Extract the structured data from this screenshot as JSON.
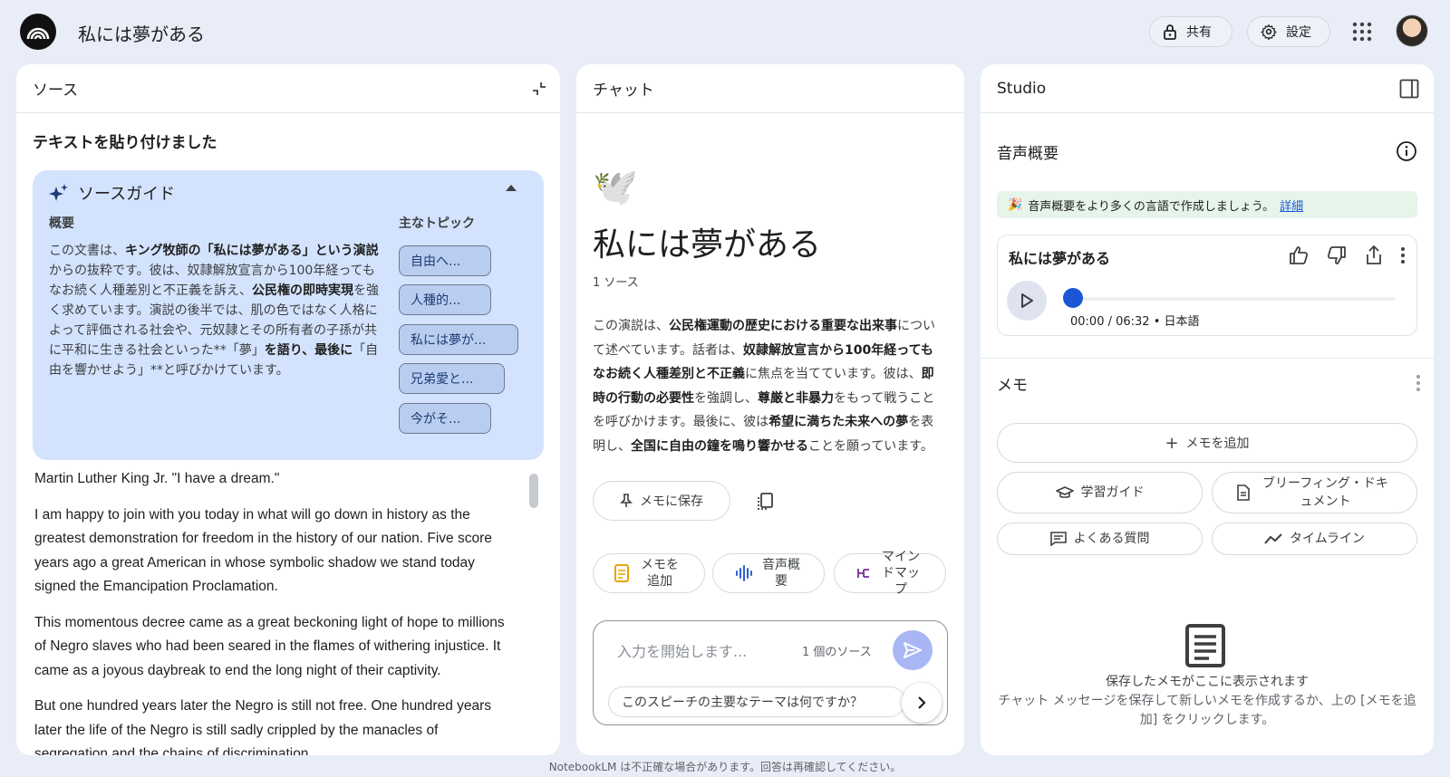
{
  "app": {
    "title": "私には夢がある",
    "share_label": "共有",
    "settings_label": "設定"
  },
  "source_panel": {
    "header": "ソース",
    "subheading": "テキストを貼り付けました",
    "guide": {
      "title": "ソースガイド",
      "summary_label": "概要",
      "topics_label": "主なトピック",
      "summary_parts": [
        "この文書は、",
        "キング牧師の「私には夢がある」という演説",
        "からの抜粋です。彼は、奴隷解放宣言から100年経ってもなお続く人種差別と不正義を訴え、",
        "公民権の即時実現",
        "を強く求めています。演説の後半では、肌の色ではなく人格によって評価される社会や、元奴隷とその所有者の子孫が共に平和に生きる社会といった**「夢」",
        "を語り、最後に",
        "「自由を響かせよう」**と呼びかけています。"
      ],
      "topics": [
        "自由へ...",
        "人種的...",
        "私には夢が...",
        "兄弟愛と...",
        "今がそ..."
      ]
    },
    "raw_text": [
      "Martin Luther King Jr. \"I have a dream.\"",
      "I am happy to join with you today in what will go down in history as the greatest demonstration for freedom in the history of our nation. Five score years ago a great American in whose symbolic shadow we stand today signed the Emancipation Proclamation.",
      "This momentous decree came as a great beckoning light of hope to millions of Negro slaves who had been seared in the flames of withering injustice. It came as a joyous daybreak to end the long night of their captivity.",
      "But one hundred years later the Negro is still not free. One hundred years later the life of the Negro is still sadly crippled by the manacles of segregation and the chains of discrimination."
    ]
  },
  "chat_panel": {
    "header": "チャット",
    "notebook_emoji": "🕊️",
    "notebook_title": "私には夢がある",
    "source_count": "1 ソース",
    "description_parts": [
      "この演説は、",
      "公民権運動の歴史における重要な出来事",
      "について述べています。話者は、",
      "奴隷解放宣言から100年経ってもなお続く人種差別と不正義",
      "に焦点を当てています。彼は、",
      "即時の行動の必要性",
      "を強調し、",
      "尊厳と非暴力",
      "をもって戦うことを呼びかけます。最後に、彼は",
      "希望に満ちた未来への夢",
      "を表明し、",
      "全国に自由の鐘を鳴り響かせる",
      "ことを願っています。"
    ],
    "save_memo_label": "メモに保存",
    "actions": [
      "メモを追加",
      "音声概要",
      "マインドマップ"
    ],
    "input_placeholder": "入力を開始します...",
    "input_source_count": "1 個のソース",
    "suggestion": "このスピーチの主要なテーマは何ですか？"
  },
  "studio_panel": {
    "header": "Studio",
    "audio_overview_label": "音声概要",
    "banner_emoji": "🎉",
    "banner_text": "音声概要をより多くの言語で作成しましょう。",
    "banner_link": "詳細",
    "audio": {
      "title": "私には夢がある",
      "time": "00:00 / 06:32 • 日本語",
      "progress": 0.0
    },
    "memo_label": "メモ",
    "add_memo_label": "メモを追加",
    "tools": [
      "学習ガイド",
      "ブリーフィング・ドキュメント",
      "よくある質問",
      "タイムライン"
    ],
    "empty_title": "保存したメモがここに表示されます",
    "empty_body": "チャット メッセージを保存して新しいメモを作成するか、上の [メモを追加] をクリックします。"
  },
  "footer": "NotebookLM は不正確な場合があります。回答は再確認してください。",
  "colors": {
    "background": "#e9edf7",
    "guide_bg": "#d3e3fd",
    "accent_blue": "#1a56d6",
    "send_button": "#a8b7f3",
    "banner_bg": "#e6f4ea"
  }
}
